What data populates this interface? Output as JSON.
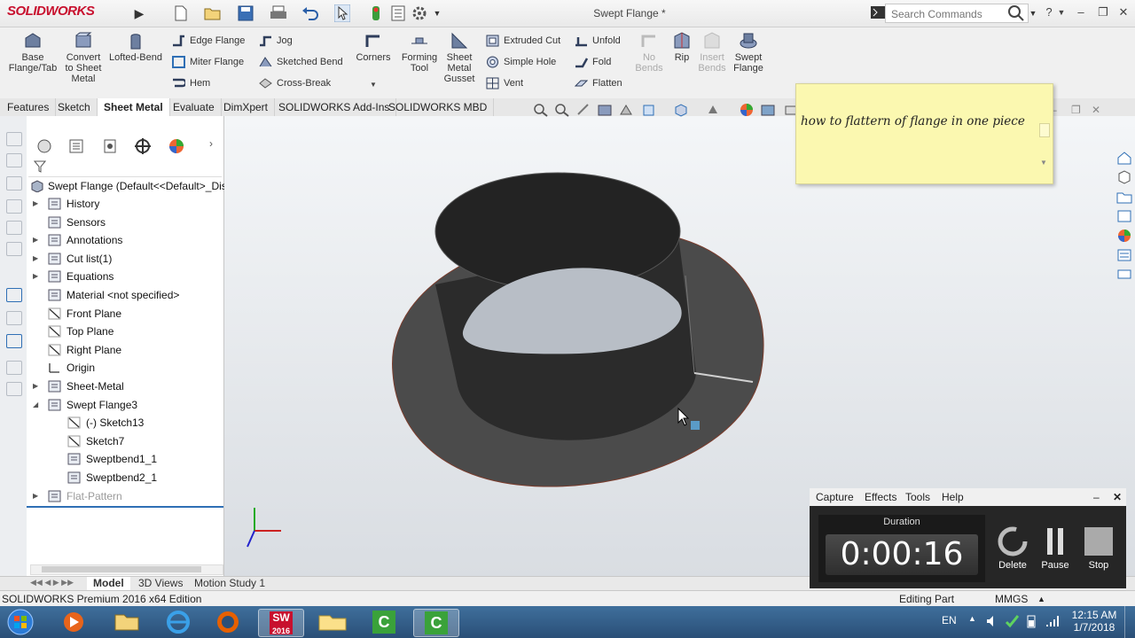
{
  "app": {
    "logo": "SOLIDWORKS",
    "document_title": "Swept Flange *",
    "search_placeholder": "Search Commands"
  },
  "command_manager": {
    "big_buttons": [
      {
        "label_line1": "Base",
        "label_line2": "Flange/Tab",
        "icon": "base-flange-icon"
      },
      {
        "label_line1": "Convert",
        "label_line2": "to Sheet",
        "label_line3": "Metal",
        "icon": "convert-sheet-metal-icon"
      },
      {
        "label_line1": "Lofted-Bend",
        "icon": "lofted-bend-icon"
      }
    ],
    "col1": [
      "Edge Flange",
      "Miter Flange",
      "Hem"
    ],
    "col2": [
      "Jog",
      "Sketched Bend",
      "Cross-Break"
    ],
    "corners": "Corners",
    "forming_tool": {
      "line1": "Forming",
      "line2": "Tool"
    },
    "gusset": {
      "line1": "Sheet",
      "line2": "Metal",
      "line3": "Gusset"
    },
    "col3": [
      "Extruded Cut",
      "Simple Hole",
      "Vent"
    ],
    "col4": [
      "Unfold",
      "Fold",
      "Flatten"
    ],
    "no_bends": {
      "line1": "No",
      "line2": "Bends"
    },
    "rip": "Rip",
    "insert_bends": {
      "line1": "Insert",
      "line2": "Bends"
    },
    "swept_flange": {
      "line1": "Swept",
      "line2": "Flange"
    }
  },
  "tabs": [
    "Features",
    "Sketch",
    "Sheet Metal",
    "Evaluate",
    "DimXpert",
    "SOLIDWORKS Add-Ins",
    "SOLIDWORKS MBD"
  ],
  "active_tab": "Sheet Metal",
  "feature_tree": {
    "root": "Swept Flange  (Default<<Default>_Displ",
    "items": [
      {
        "label": "History",
        "expandable": true,
        "level": 0
      },
      {
        "label": "Sensors",
        "expandable": false,
        "level": 0
      },
      {
        "label": "Annotations",
        "expandable": true,
        "level": 0
      },
      {
        "label": "Cut list(1)",
        "expandable": true,
        "level": 0
      },
      {
        "label": "Equations",
        "expandable": true,
        "level": 0
      },
      {
        "label": "Material <not specified>",
        "expandable": false,
        "level": 0
      },
      {
        "label": "Front Plane",
        "expandable": false,
        "level": 0
      },
      {
        "label": "Top Plane",
        "expandable": false,
        "level": 0
      },
      {
        "label": "Right Plane",
        "expandable": false,
        "level": 0
      },
      {
        "label": "Origin",
        "expandable": false,
        "level": 0
      },
      {
        "label": "Sheet-Metal",
        "expandable": true,
        "level": 0
      },
      {
        "label": "Swept Flange3",
        "expandable": true,
        "expanded": true,
        "level": 0
      },
      {
        "label": "(-) Sketch13",
        "expandable": false,
        "level": 1
      },
      {
        "label": "Sketch7",
        "expandable": false,
        "level": 1
      },
      {
        "label": "Sweptbend1_1",
        "expandable": false,
        "level": 1
      },
      {
        "label": "Sweptbend2_1",
        "expandable": false,
        "level": 1
      },
      {
        "label": "Flat-Pattern",
        "expandable": true,
        "level": 0,
        "dimmed": true
      }
    ]
  },
  "note": {
    "text": "how to flattern of flange in one piece"
  },
  "bottom_tabs": [
    "Model",
    "3D Views",
    "Motion Study 1"
  ],
  "active_bottom_tab": "Model",
  "status": {
    "left": "SOLIDWORKS Premium 2016 x64 Edition",
    "mode": "Editing Part",
    "units": "MMGS"
  },
  "recorder": {
    "menu": [
      "Capture",
      "Effects",
      "Tools",
      "Help"
    ],
    "duration_label": "Duration",
    "duration_value": "0:00:16",
    "buttons": [
      "Delete",
      "Pause",
      "Stop"
    ]
  },
  "taskbar": {
    "language": "EN",
    "time": "12:15 AM",
    "date": "1/7/2018",
    "sw_badge": "2016"
  },
  "colors": {
    "accent": "#c8102e",
    "part_dark": "#262626",
    "part_flange": "#4a4a4a",
    "note_bg": "#fbf8b0"
  }
}
